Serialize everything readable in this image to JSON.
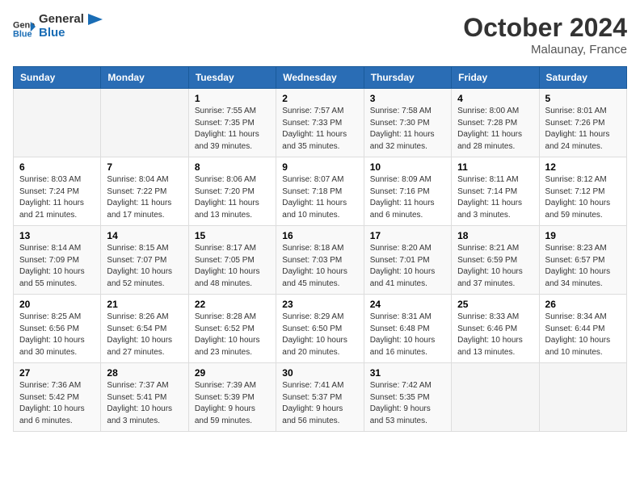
{
  "header": {
    "logo_line1": "General",
    "logo_line2": "Blue",
    "month": "October 2024",
    "location": "Malaunay, France"
  },
  "weekdays": [
    "Sunday",
    "Monday",
    "Tuesday",
    "Wednesday",
    "Thursday",
    "Friday",
    "Saturday"
  ],
  "weeks": [
    [
      {
        "day": "",
        "sunrise": "",
        "sunset": "",
        "daylight": ""
      },
      {
        "day": "",
        "sunrise": "",
        "sunset": "",
        "daylight": ""
      },
      {
        "day": "1",
        "sunrise": "Sunrise: 7:55 AM",
        "sunset": "Sunset: 7:35 PM",
        "daylight": "Daylight: 11 hours and 39 minutes."
      },
      {
        "day": "2",
        "sunrise": "Sunrise: 7:57 AM",
        "sunset": "Sunset: 7:33 PM",
        "daylight": "Daylight: 11 hours and 35 minutes."
      },
      {
        "day": "3",
        "sunrise": "Sunrise: 7:58 AM",
        "sunset": "Sunset: 7:30 PM",
        "daylight": "Daylight: 11 hours and 32 minutes."
      },
      {
        "day": "4",
        "sunrise": "Sunrise: 8:00 AM",
        "sunset": "Sunset: 7:28 PM",
        "daylight": "Daylight: 11 hours and 28 minutes."
      },
      {
        "day": "5",
        "sunrise": "Sunrise: 8:01 AM",
        "sunset": "Sunset: 7:26 PM",
        "daylight": "Daylight: 11 hours and 24 minutes."
      }
    ],
    [
      {
        "day": "6",
        "sunrise": "Sunrise: 8:03 AM",
        "sunset": "Sunset: 7:24 PM",
        "daylight": "Daylight: 11 hours and 21 minutes."
      },
      {
        "day": "7",
        "sunrise": "Sunrise: 8:04 AM",
        "sunset": "Sunset: 7:22 PM",
        "daylight": "Daylight: 11 hours and 17 minutes."
      },
      {
        "day": "8",
        "sunrise": "Sunrise: 8:06 AM",
        "sunset": "Sunset: 7:20 PM",
        "daylight": "Daylight: 11 hours and 13 minutes."
      },
      {
        "day": "9",
        "sunrise": "Sunrise: 8:07 AM",
        "sunset": "Sunset: 7:18 PM",
        "daylight": "Daylight: 11 hours and 10 minutes."
      },
      {
        "day": "10",
        "sunrise": "Sunrise: 8:09 AM",
        "sunset": "Sunset: 7:16 PM",
        "daylight": "Daylight: 11 hours and 6 minutes."
      },
      {
        "day": "11",
        "sunrise": "Sunrise: 8:11 AM",
        "sunset": "Sunset: 7:14 PM",
        "daylight": "Daylight: 11 hours and 3 minutes."
      },
      {
        "day": "12",
        "sunrise": "Sunrise: 8:12 AM",
        "sunset": "Sunset: 7:12 PM",
        "daylight": "Daylight: 10 hours and 59 minutes."
      }
    ],
    [
      {
        "day": "13",
        "sunrise": "Sunrise: 8:14 AM",
        "sunset": "Sunset: 7:09 PM",
        "daylight": "Daylight: 10 hours and 55 minutes."
      },
      {
        "day": "14",
        "sunrise": "Sunrise: 8:15 AM",
        "sunset": "Sunset: 7:07 PM",
        "daylight": "Daylight: 10 hours and 52 minutes."
      },
      {
        "day": "15",
        "sunrise": "Sunrise: 8:17 AM",
        "sunset": "Sunset: 7:05 PM",
        "daylight": "Daylight: 10 hours and 48 minutes."
      },
      {
        "day": "16",
        "sunrise": "Sunrise: 8:18 AM",
        "sunset": "Sunset: 7:03 PM",
        "daylight": "Daylight: 10 hours and 45 minutes."
      },
      {
        "day": "17",
        "sunrise": "Sunrise: 8:20 AM",
        "sunset": "Sunset: 7:01 PM",
        "daylight": "Daylight: 10 hours and 41 minutes."
      },
      {
        "day": "18",
        "sunrise": "Sunrise: 8:21 AM",
        "sunset": "Sunset: 6:59 PM",
        "daylight": "Daylight: 10 hours and 37 minutes."
      },
      {
        "day": "19",
        "sunrise": "Sunrise: 8:23 AM",
        "sunset": "Sunset: 6:57 PM",
        "daylight": "Daylight: 10 hours and 34 minutes."
      }
    ],
    [
      {
        "day": "20",
        "sunrise": "Sunrise: 8:25 AM",
        "sunset": "Sunset: 6:56 PM",
        "daylight": "Daylight: 10 hours and 30 minutes."
      },
      {
        "day": "21",
        "sunrise": "Sunrise: 8:26 AM",
        "sunset": "Sunset: 6:54 PM",
        "daylight": "Daylight: 10 hours and 27 minutes."
      },
      {
        "day": "22",
        "sunrise": "Sunrise: 8:28 AM",
        "sunset": "Sunset: 6:52 PM",
        "daylight": "Daylight: 10 hours and 23 minutes."
      },
      {
        "day": "23",
        "sunrise": "Sunrise: 8:29 AM",
        "sunset": "Sunset: 6:50 PM",
        "daylight": "Daylight: 10 hours and 20 minutes."
      },
      {
        "day": "24",
        "sunrise": "Sunrise: 8:31 AM",
        "sunset": "Sunset: 6:48 PM",
        "daylight": "Daylight: 10 hours and 16 minutes."
      },
      {
        "day": "25",
        "sunrise": "Sunrise: 8:33 AM",
        "sunset": "Sunset: 6:46 PM",
        "daylight": "Daylight: 10 hours and 13 minutes."
      },
      {
        "day": "26",
        "sunrise": "Sunrise: 8:34 AM",
        "sunset": "Sunset: 6:44 PM",
        "daylight": "Daylight: 10 hours and 10 minutes."
      }
    ],
    [
      {
        "day": "27",
        "sunrise": "Sunrise: 7:36 AM",
        "sunset": "Sunset: 5:42 PM",
        "daylight": "Daylight: 10 hours and 6 minutes."
      },
      {
        "day": "28",
        "sunrise": "Sunrise: 7:37 AM",
        "sunset": "Sunset: 5:41 PM",
        "daylight": "Daylight: 10 hours and 3 minutes."
      },
      {
        "day": "29",
        "sunrise": "Sunrise: 7:39 AM",
        "sunset": "Sunset: 5:39 PM",
        "daylight": "Daylight: 9 hours and 59 minutes."
      },
      {
        "day": "30",
        "sunrise": "Sunrise: 7:41 AM",
        "sunset": "Sunset: 5:37 PM",
        "daylight": "Daylight: 9 hours and 56 minutes."
      },
      {
        "day": "31",
        "sunrise": "Sunrise: 7:42 AM",
        "sunset": "Sunset: 5:35 PM",
        "daylight": "Daylight: 9 hours and 53 minutes."
      },
      {
        "day": "",
        "sunrise": "",
        "sunset": "",
        "daylight": ""
      },
      {
        "day": "",
        "sunrise": "",
        "sunset": "",
        "daylight": ""
      }
    ]
  ]
}
